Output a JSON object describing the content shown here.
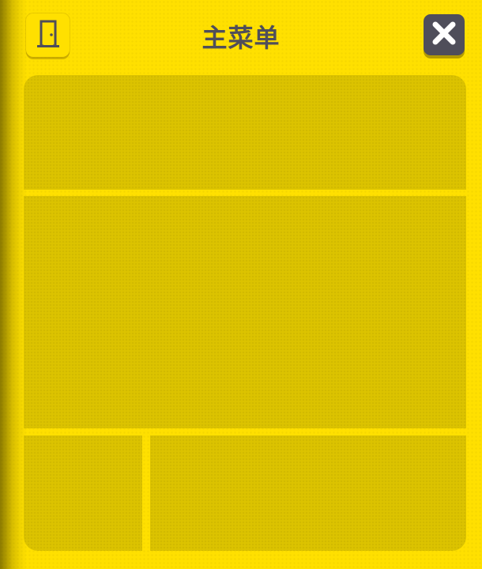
{
  "header": {
    "title": "主菜单",
    "left_button_icon": "door-icon",
    "right_button_icon": "close-icon"
  },
  "colors": {
    "background": "#ffe000",
    "panel": "#dcc300",
    "text_dark": "#4f4e5a",
    "button_dark": "#4f4e5a"
  }
}
